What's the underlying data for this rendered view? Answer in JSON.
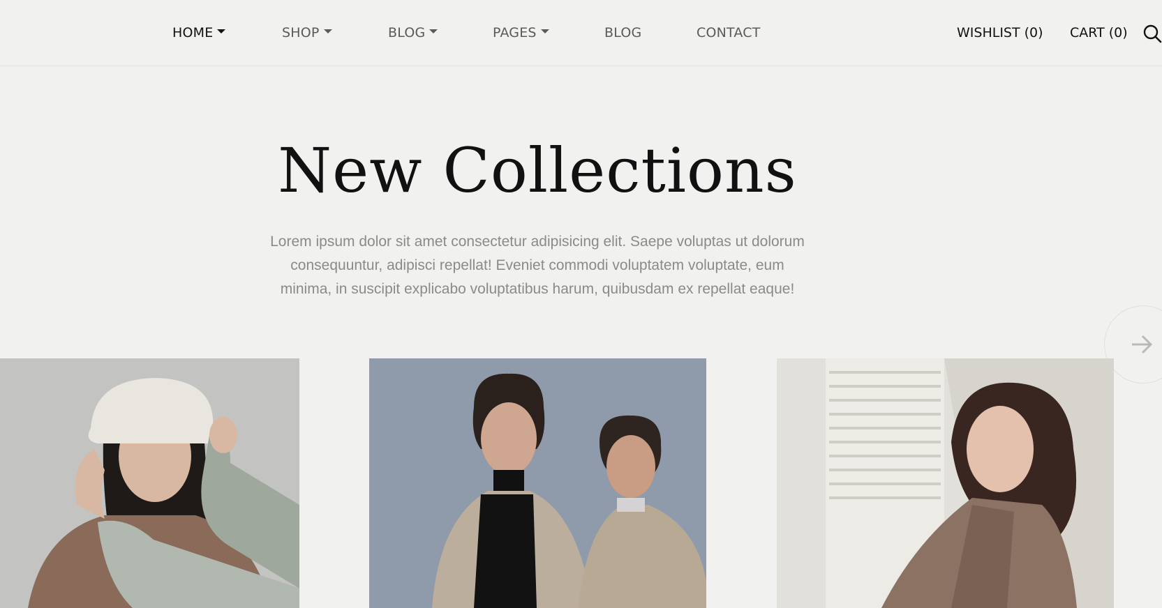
{
  "nav": {
    "items": [
      {
        "label": "HOME",
        "dropdown": true,
        "active": true
      },
      {
        "label": "SHOP",
        "dropdown": true,
        "active": false
      },
      {
        "label": "BLOG",
        "dropdown": true,
        "active": false
      },
      {
        "label": "PAGES",
        "dropdown": true,
        "active": false
      },
      {
        "label": "BLOG",
        "dropdown": false,
        "active": false
      },
      {
        "label": "CONTACT",
        "dropdown": false,
        "active": false
      }
    ]
  },
  "header_right": {
    "wishlist_label": "WISHLIST (0)",
    "cart_label": "CART (0)",
    "search_icon": "search-icon"
  },
  "hero": {
    "title": "New Collections",
    "description": "Lorem ipsum dolor sit amet consectetur adipisicing elit. Saepe voluptas ut dolorum consequuntur, adipisci repellat! Eveniet commodi voluptatem voluptate, eum minima, in suscipit explicabo voluptatibus harum, quibusdam ex repellat eaque!"
  },
  "carousel": {
    "next_icon": "arrow-right-icon"
  },
  "colors": {
    "background": "#f1f1ef",
    "text_primary": "#111111",
    "text_muted": "#8a8a8a",
    "nav_inactive": "#5a5a5a"
  }
}
